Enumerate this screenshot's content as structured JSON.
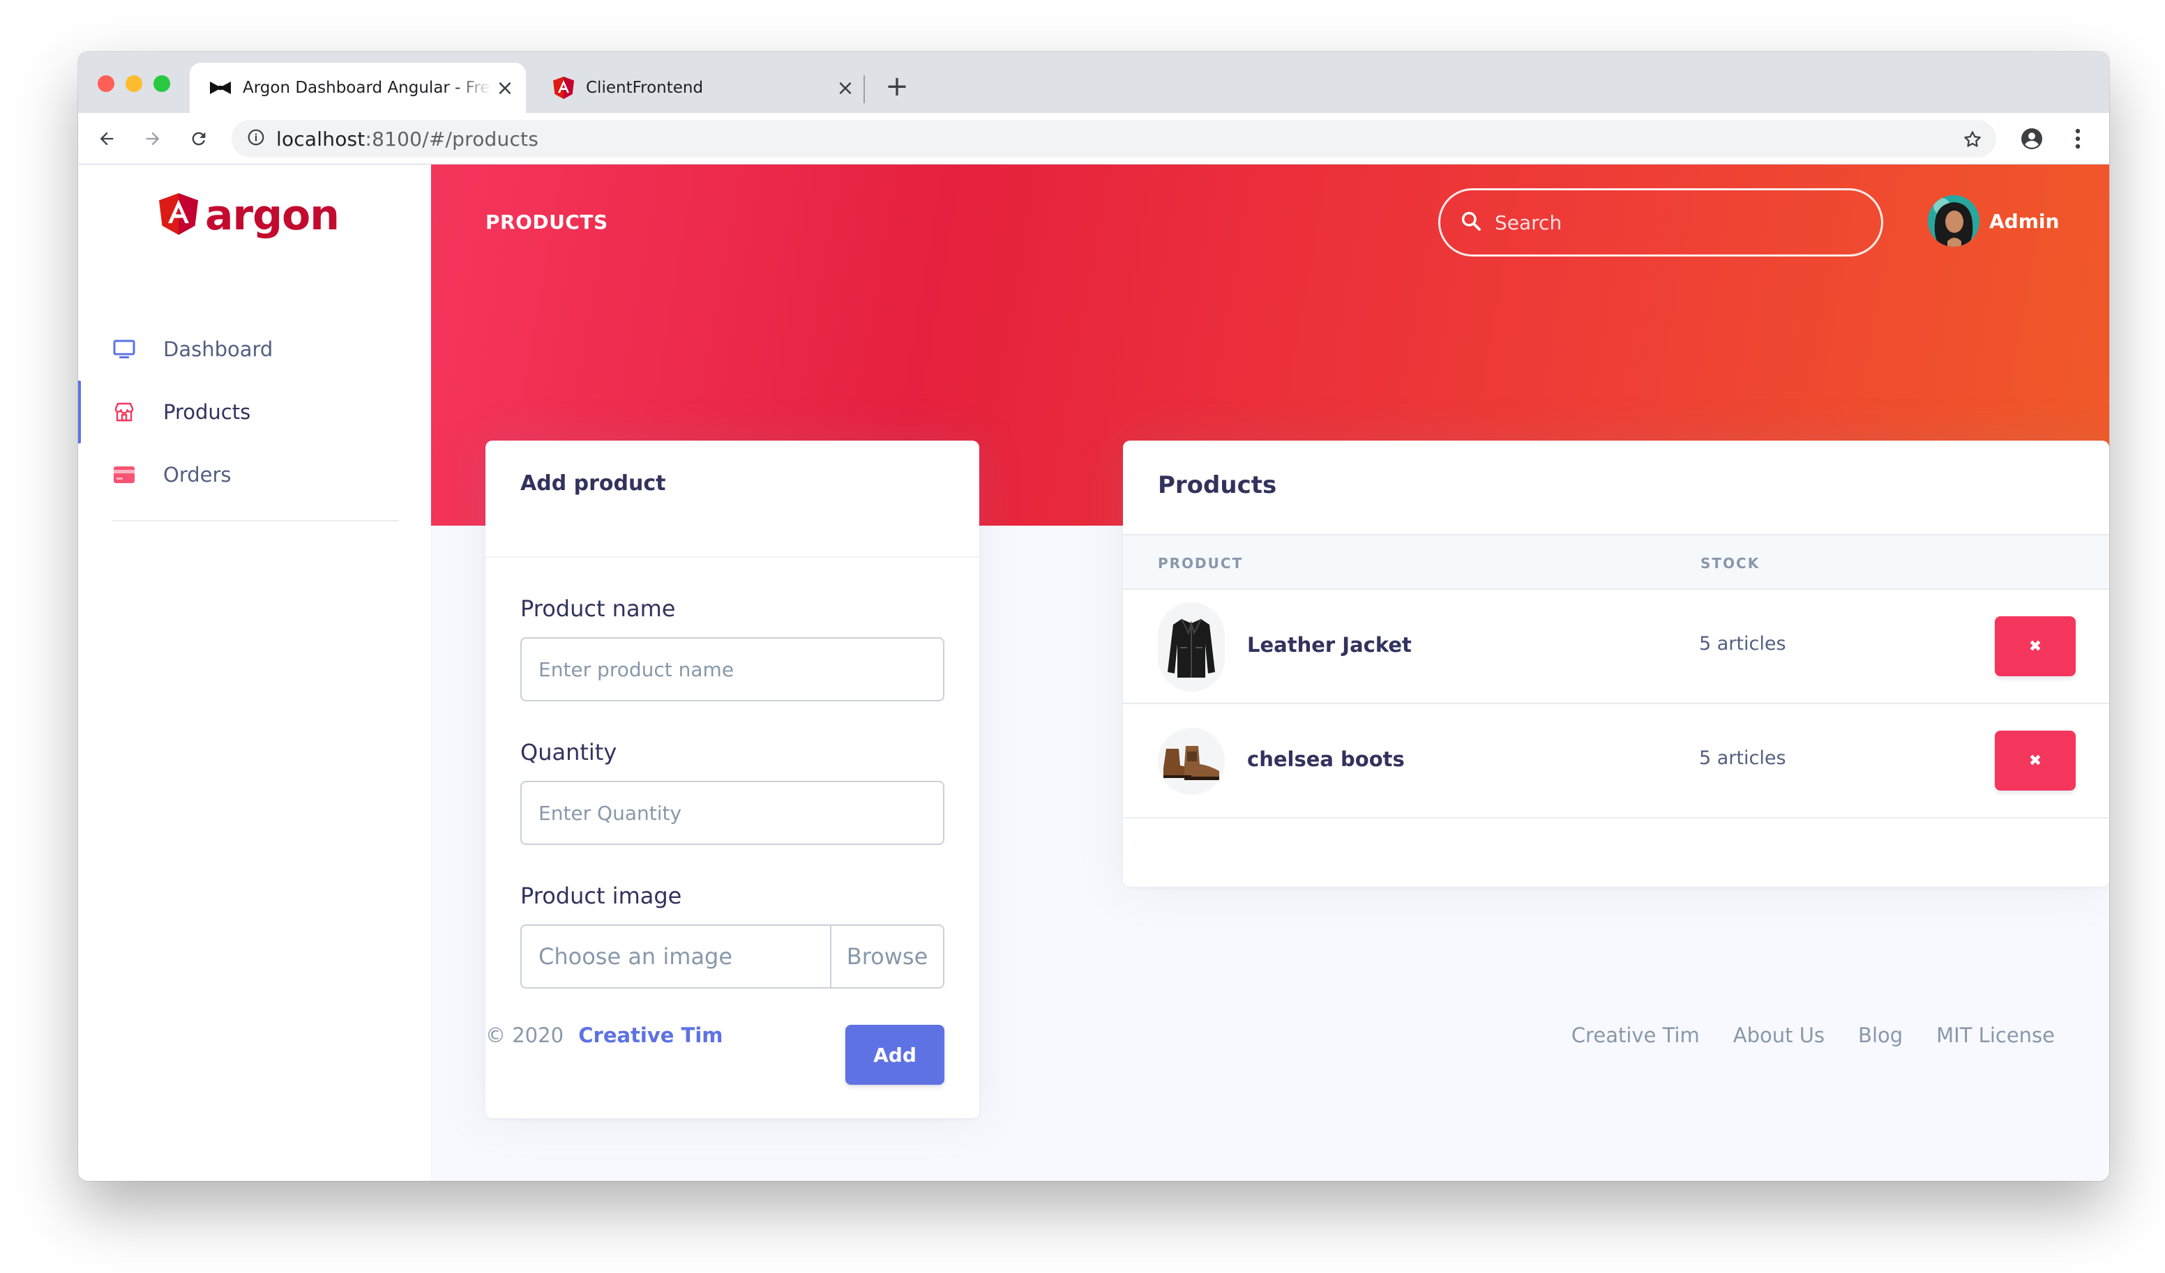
{
  "browser": {
    "tabs": [
      {
        "title": "Argon Dashboard Angular - Free",
        "icon": "bowtie-icon"
      },
      {
        "title": "ClientFrontend",
        "icon": "angular-icon"
      }
    ],
    "url_host": "localhost",
    "url_rest": ":8100/#/products"
  },
  "sidebar": {
    "brand": "argon",
    "items": [
      {
        "label": "Dashboard",
        "icon": "tv-icon",
        "color": "#5e72e4"
      },
      {
        "label": "Products",
        "icon": "shop-icon",
        "color": "#f5365c",
        "active": true
      },
      {
        "label": "Orders",
        "icon": "credit-card-icon",
        "color": "#f5365c"
      }
    ]
  },
  "header": {
    "page_title": "PRODUCTS",
    "search_placeholder": "Search",
    "user_name": "Admin"
  },
  "add_product": {
    "title": "Add product",
    "name_label": "Product name",
    "name_placeholder": "Enter product name",
    "quantity_label": "Quantity",
    "quantity_placeholder": "Enter Quantity",
    "image_label": "Product image",
    "image_placeholder": "Choose an image",
    "browse_label": "Browse",
    "submit_label": "Add"
  },
  "products": {
    "title": "Products",
    "columns": [
      "PRODUCT",
      "STOCK"
    ],
    "rows": [
      {
        "name": "Leather Jacket",
        "stock": "5 articles",
        "thumb": "jacket"
      },
      {
        "name": "chelsea boots",
        "stock": "5 articles",
        "thumb": "boots"
      }
    ],
    "delete_glyph": "✖"
  },
  "footer": {
    "copyright": "© 2020",
    "company": "Creative Tim",
    "links": [
      "Creative Tim",
      "About Us",
      "Blog",
      "MIT License"
    ]
  },
  "colors": {
    "primary": "#5e72e4",
    "danger": "#f5365c",
    "brand": "#c30b2f"
  }
}
